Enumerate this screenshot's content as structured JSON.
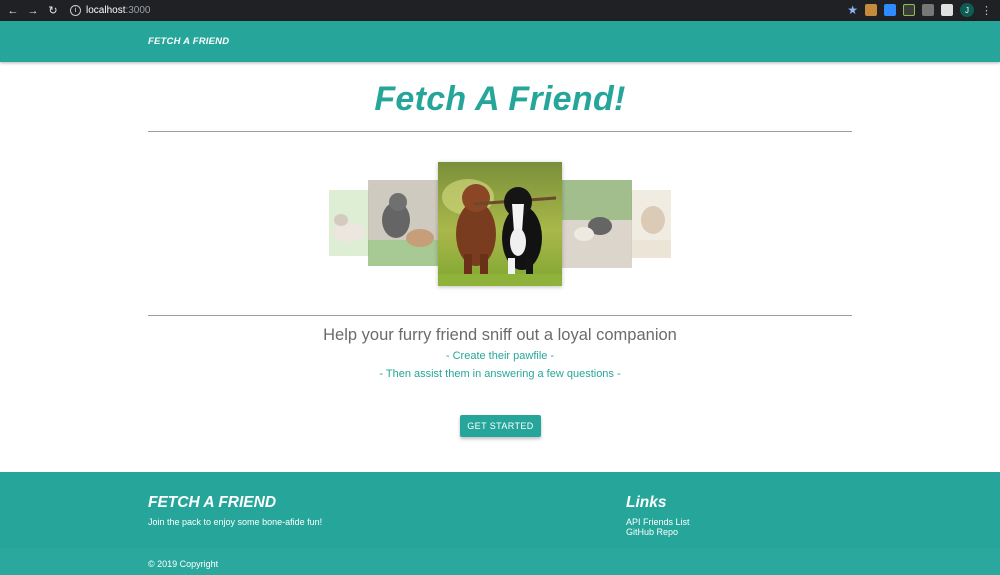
{
  "browser": {
    "url_host": "localhost",
    "url_port": ":3000"
  },
  "navbar": {
    "brand": "FETCH A FRIEND"
  },
  "hero": {
    "title": "Fetch A Friend!",
    "tagline": "Help your furry friend sniff out a loyal companion",
    "step1": "- Create their pawfile -",
    "step2": "- Then assist them in answering a few questions -",
    "button_label": "GET STARTED"
  },
  "carousel": {
    "items": [
      {
        "name": "dogs-playing-photo-far-left",
        "icon": "dog-photo"
      },
      {
        "name": "dogs-wrestling-photo-left",
        "icon": "dog-photo"
      },
      {
        "name": "dogs-running-with-stick-photo-center",
        "icon": "dog-photo"
      },
      {
        "name": "puppies-playing-photo-right",
        "icon": "dog-photo"
      },
      {
        "name": "dogs-photo-far-right",
        "icon": "dog-photo"
      }
    ]
  },
  "footer": {
    "title": "FETCH A FRIEND",
    "tagline": "Join the pack to enjoy some bone-afide fun!",
    "links_heading": "Links",
    "links": [
      "API Friends List",
      "GitHub Repo"
    ],
    "copyright": "© 2019 Copyright"
  },
  "colors": {
    "primary": "#26a69a",
    "text_gray": "#6b6b6b"
  }
}
